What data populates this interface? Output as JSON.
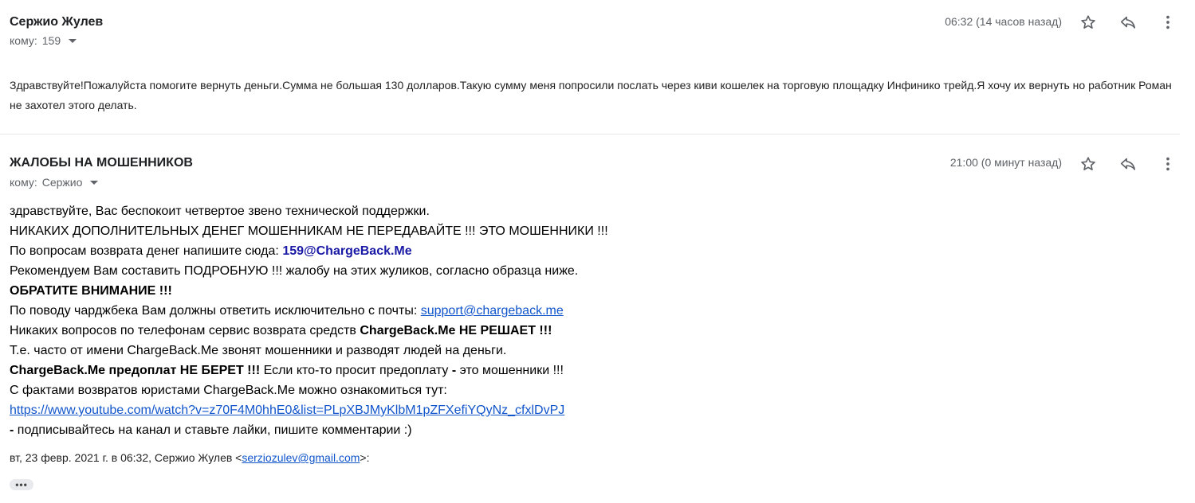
{
  "messages": [
    {
      "sender": "Сержио Жулев",
      "recipient_prefix": "кому:",
      "recipient": "159",
      "time": "06:32 (14 часов назад)",
      "icons": [
        "star-icon",
        "reply-icon",
        "more-vert-icon"
      ],
      "body": "Здравствуйте!Пожалуйста помогите вернуть деньги.Сумма не большая 130 долларов.Такую сумму меня попросили послать через киви кошелек на торговую площадку Инфинико трейд.Я хочу их вернуть но работник Роман не захотел этого делать."
    },
    {
      "sender": "ЖАЛОБЫ НА МОШЕННИКОВ",
      "recipient_prefix": "кому:",
      "recipient": "Сержио",
      "time": "21:00 (0 минут назад)",
      "icons": [
        "star-icon",
        "reply-icon",
        "more-vert-icon"
      ],
      "body": {
        "l1": "здравствуйте, Вас беспокоит четвертое звено технической поддержки.",
        "l2": "НИКАКИХ ДОПОЛНИТЕЛЬНЫХ ДЕНЕГ МОШЕННИКАМ НЕ ПЕРЕДАВАЙТЕ !!! ЭТО МОШЕННИКИ !!!",
        "l3_text": "По вопросам возврата денег напишите сюда: ",
        "l3_email": "159@ChargeBack.Me",
        "l4": "Рекомендуем Вам составить ПОДРОБНУЮ !!! жалобу на этих жуликов, согласно образца ниже.",
        "l5": "ОБРАТИТЕ ВНИМАНИЕ !!!",
        "l6_text": "По поводу чарджбека Вам должны ответить исключительно с почты: ",
        "l6_link": "support@chargeback.me",
        "l7_text": "Никаких вопросов по телефонам сервис возврата средств ",
        "l7_bold": "ChargeBack.Me НЕ РЕШАЕТ !!!",
        "l8": "Т.е. часто от имени ChargeBack.Me звонят мошенники и разводят людей на деньги.",
        "l9_bold": "ChargeBack.Me предоплат НЕ БЕРЕТ !!!",
        "l9_text": " Если кто-то просит предоплату ",
        "l9_dash": "-",
        "l9_tail": " это мошенники !!!",
        "l10": "С фактами возвратов юристами ChargeBack.Me можно ознакомиться тут:",
        "l11_link": "https://www.youtube.com/watch?v=z70F4M0hhE0&list=PLpXBJMyKlbM1pZFXefiYQyNz_cfxlDvPJ",
        "l12_dash": " -",
        "l12_text": " подписывайтесь на канал и ставьте лайки, пишите комментарии :)"
      },
      "quote_header": {
        "prefix": "вт, 23 февр. 2021 г. в 06:32, Сержио Жулев <",
        "email": "serziozulev@gmail.com",
        "suffix": ">:"
      },
      "ellipsis": "•••"
    }
  ],
  "colors": {
    "link": "#1155cc",
    "bold_email": "#1a1aa6",
    "secondary_text": "#5f6368"
  }
}
